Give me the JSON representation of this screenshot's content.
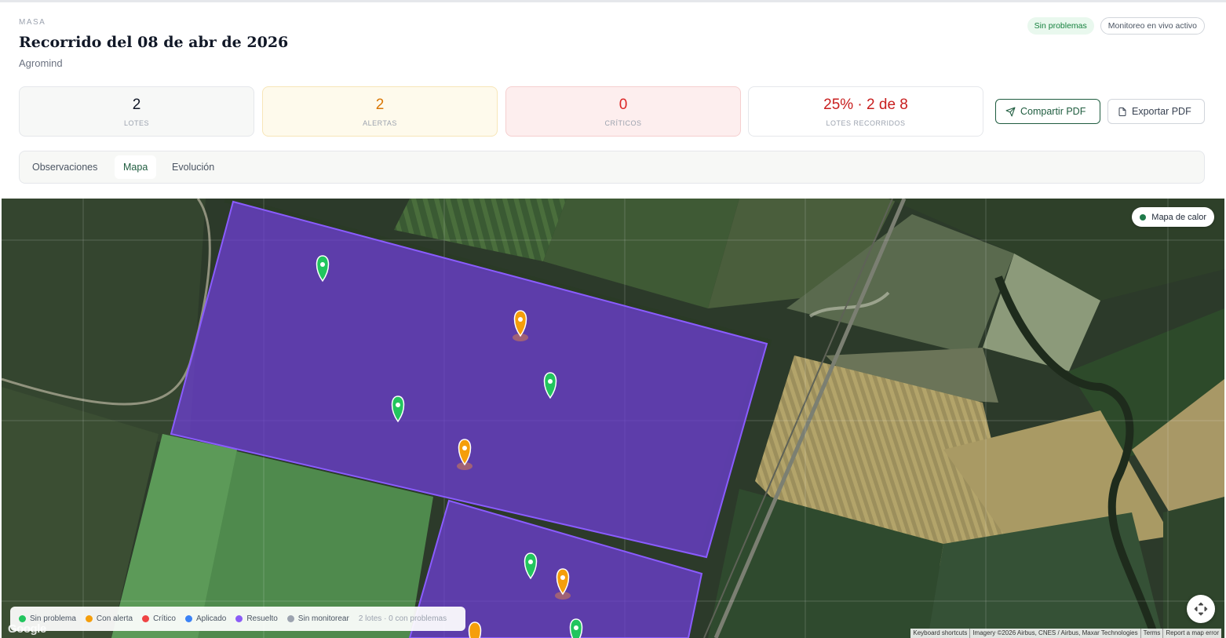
{
  "header": {
    "eyebrow": "MASA",
    "title": "Recorrido del 08 de abr de 2026",
    "subtitle": "Agromind",
    "badges": {
      "status": "Sin problemas",
      "live": "Monitoreo en vivo activo"
    }
  },
  "stats": [
    {
      "value": "2",
      "label": "LOTES"
    },
    {
      "value": "2",
      "label": "ALERTAS"
    },
    {
      "value": "0",
      "label": "CRÍTICOS"
    },
    {
      "value": "25% · 2 de 8",
      "label": "LOTES RECORRIDOS"
    }
  ],
  "actions": {
    "share": "Compartir PDF",
    "export": "Exportar PDF"
  },
  "tabs": [
    {
      "label": "Observaciones",
      "active": false
    },
    {
      "label": "Mapa",
      "active": true
    },
    {
      "label": "Evolución",
      "active": false
    }
  ],
  "map": {
    "heatmap_toggle": "Mapa de calor",
    "legend": [
      {
        "label": "Sin problema",
        "color": "#22c55e"
      },
      {
        "label": "Con alerta",
        "color": "#f59e0b"
      },
      {
        "label": "Crítico",
        "color": "#ef4444"
      },
      {
        "label": "Aplicado",
        "color": "#3b82f6"
      },
      {
        "label": "Resuelto",
        "color": "#8b5cf6"
      },
      {
        "label": "Sin monitorear",
        "color": "#9ca3af"
      }
    ],
    "legend_summary": "2 lotes · 0 con problemas",
    "google_logo": "Google",
    "attribution": [
      "Keyboard shortcuts",
      "Imagery ©2026 Airbus, CNES / Airbus, Maxar Technologies",
      "Terms",
      "Report a map error"
    ],
    "lot_color": "#6d3fd6",
    "markers": [
      {
        "status": "ok"
      },
      {
        "status": "alert"
      },
      {
        "status": "ok"
      },
      {
        "status": "ok"
      },
      {
        "status": "alert"
      },
      {
        "status": "ok"
      },
      {
        "status": "alert"
      },
      {
        "status": "alert"
      },
      {
        "status": "ok"
      }
    ]
  }
}
